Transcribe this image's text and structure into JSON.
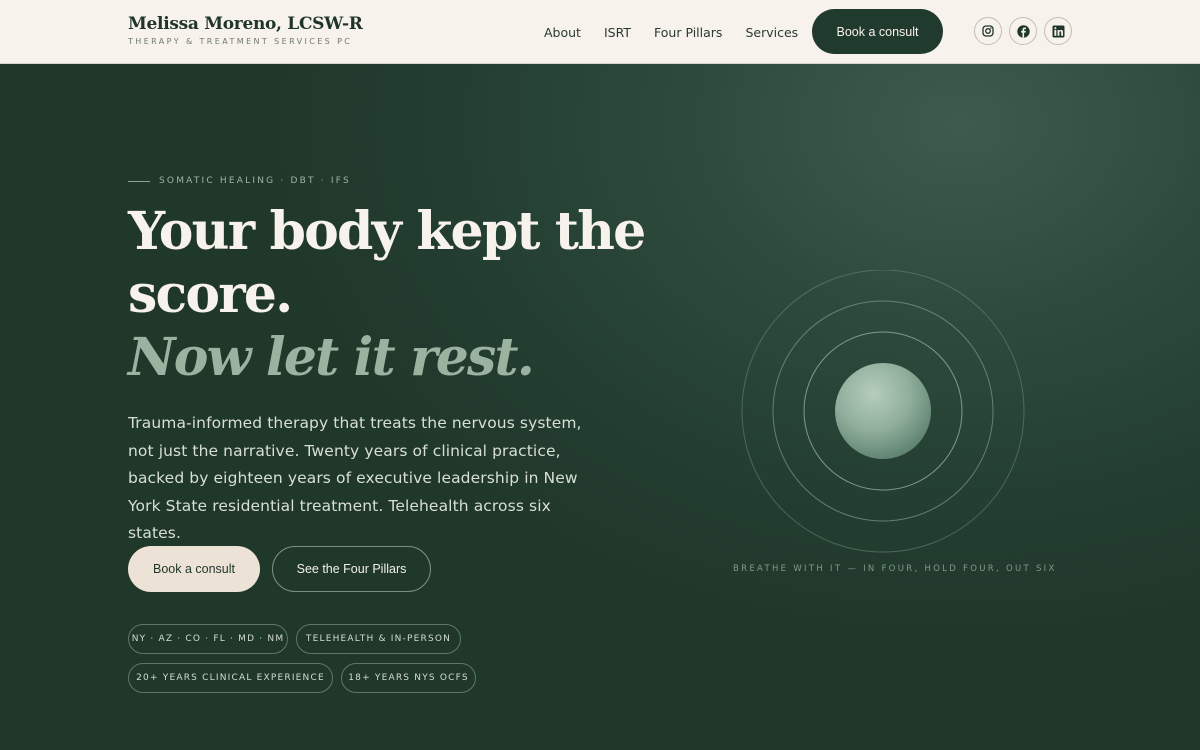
{
  "header": {
    "brand_name": "Melissa Moreno, LCSW-R",
    "brand_sub": "THERAPY & TREATMENT SERVICES PC",
    "nav": [
      "About",
      "ISRT",
      "Four Pillars",
      "Services"
    ],
    "cta": "Book a consult",
    "social": [
      "instagram-icon",
      "facebook-icon",
      "linkedin-icon"
    ]
  },
  "hero": {
    "eyebrow": "SOMATIC HEALING · DBT · IFS",
    "headline_1": "Your body kept the",
    "headline_2": "score.",
    "headline_3": "Now let it rest.",
    "lead": "Trauma-informed therapy that treats the nervous system, not just the narrative. Twenty years of clinical practice, backed by eighteen years of executive leadership in New York State residential treatment. Telehealth across six states.",
    "primary_button": "Book a consult",
    "secondary_button": "See the Four Pillars",
    "chips": [
      "NY · AZ · CO · FL · MD · NM",
      "TELEHEALTH & IN-PERSON",
      "20+ YEARS CLINICAL EXPERIENCE",
      "18+ YEARS NYS OCFS"
    ],
    "breath_caption": "BREATHE WITH IT — IN FOUR, HOLD FOUR, OUT SIX"
  },
  "colors": {
    "header_bg": "#f7f2eb",
    "hero_bg": "#233d31",
    "accent_green": "#9ab29f",
    "cream_button": "#ece2d6",
    "dark_button": "#213a2e"
  }
}
